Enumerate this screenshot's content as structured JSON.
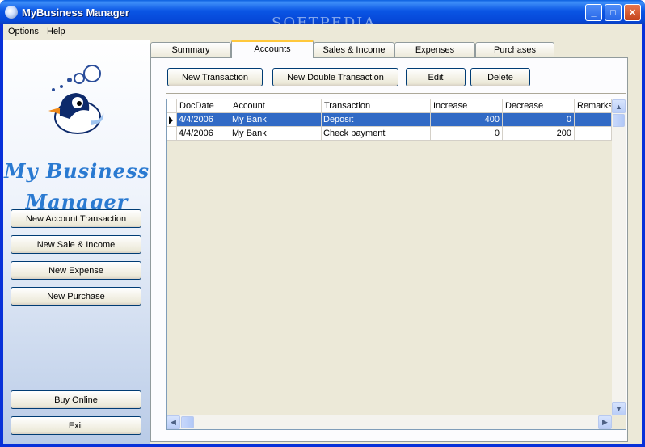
{
  "window": {
    "title": "MyBusiness Manager",
    "watermark": "SOFTPEDIA"
  },
  "title_buttons": {
    "minimize": "_",
    "maximize": "□",
    "close": "✕"
  },
  "menu": [
    "Options",
    "Help"
  ],
  "sidebar": {
    "brand_line1": "My Business",
    "brand_line2": "Manager",
    "buttons": [
      "New Account Transaction",
      "New Sale & Income",
      "New Expense",
      "New Purchase"
    ],
    "bottom_buttons": [
      "Buy Online",
      "Exit"
    ]
  },
  "tabs": [
    "Summary",
    "Accounts",
    "Sales & Income",
    "Expenses",
    "Purchases"
  ],
  "active_tab": "Accounts",
  "toolbar": [
    "New Transaction",
    "New Double Transaction",
    "Edit",
    "Delete"
  ],
  "grid": {
    "columns": [
      "DocDate",
      "Account",
      "Transaction",
      "Increase",
      "Decrease",
      "Remarks"
    ],
    "rows": [
      [
        "4/4/2006",
        "My Bank",
        "Deposit",
        "400",
        "0",
        ""
      ],
      [
        "4/4/2006",
        "My Bank",
        "Check payment",
        "0",
        "200",
        ""
      ]
    ],
    "selected_row": 0
  },
  "icons": {
    "app": "app-icon",
    "logo": "penguin-logo",
    "row_pointer": "row-pointer-icon"
  },
  "colors": {
    "titlebar": "#0a55e4",
    "selection": "#316ac5",
    "brand": "#2a7ad1",
    "active_tab_accent": "#ffc83c"
  }
}
